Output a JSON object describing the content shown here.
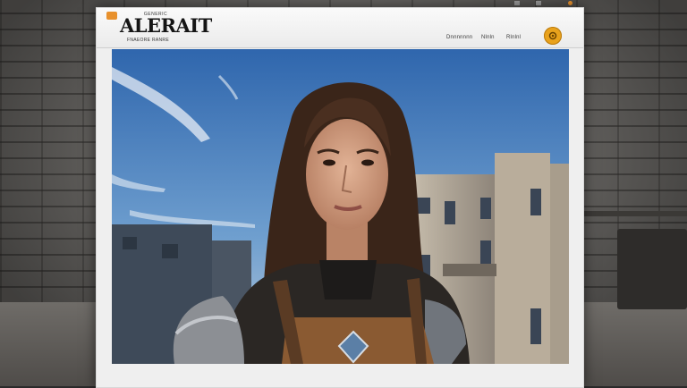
{
  "header": {
    "logo_top": "GENERIC",
    "logo_main": "ALERAIT",
    "logo_sub": "FNAEORE RANRE"
  },
  "nav": {
    "items": [
      {
        "label": "Dnnnnnnn"
      },
      {
        "label": "Nlnln"
      },
      {
        "label": "Rlnlnl"
      }
    ]
  },
  "icons": {
    "settings": "gear-icon",
    "app_badge": "app-badge-icon"
  },
  "colors": {
    "accent": "#e9a21c",
    "window_bg": "#efefef",
    "sky": "#4c7fb8"
  }
}
